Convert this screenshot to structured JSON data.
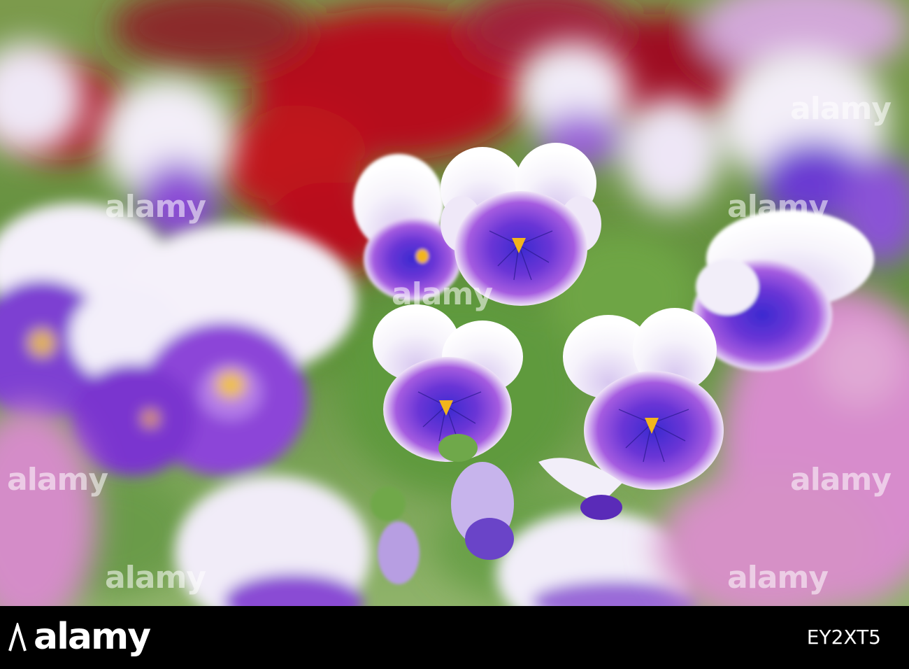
{
  "footer": {
    "logo": "alamy",
    "image_id": "EY2XT5"
  },
  "watermark": {
    "text": "alamy"
  },
  "colors": {
    "petal_white": "#f4f1fa",
    "petal_purple": "#7a3ad0",
    "petal_violet": "#5a2bb8",
    "center_yellow": "#f2b51c",
    "background_red": "#b3121e",
    "background_pink": "#d889c8",
    "foliage_green": "#6f9a4a",
    "footer_black": "#000000"
  }
}
